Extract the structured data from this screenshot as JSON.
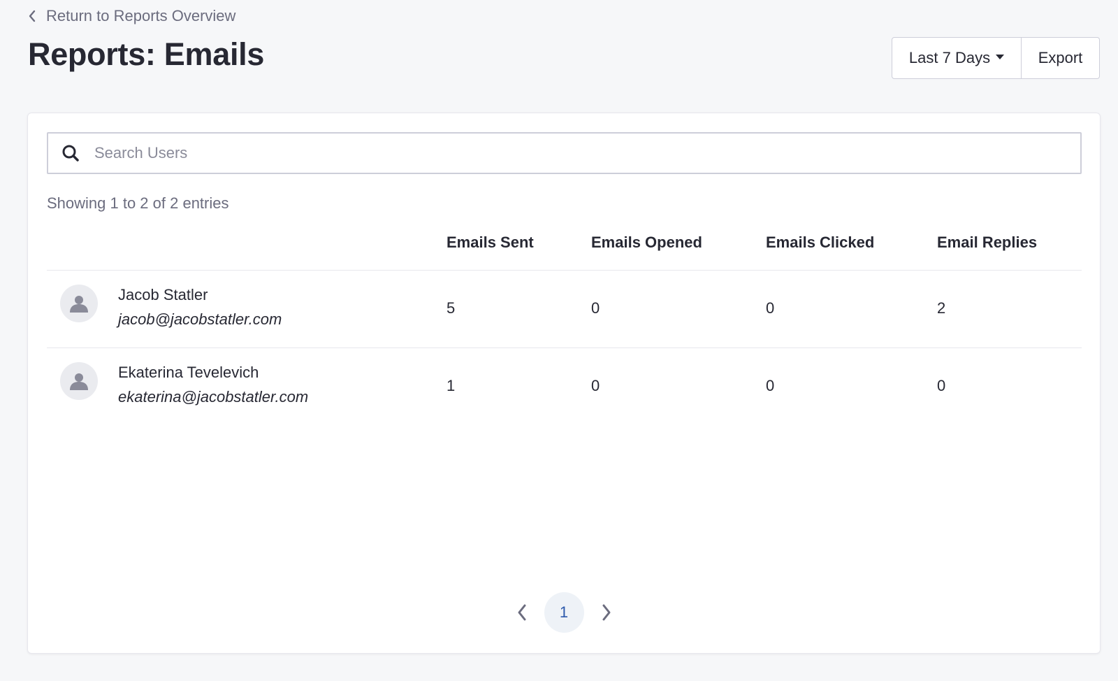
{
  "nav": {
    "back_label": "Return to Reports Overview"
  },
  "header": {
    "title": "Reports: Emails",
    "range_label": "Last 7 Days",
    "export_label": "Export"
  },
  "search": {
    "placeholder": "Search Users",
    "value": ""
  },
  "table": {
    "info": "Showing 1 to 2 of 2 entries",
    "columns": [
      "Emails Sent",
      "Emails Opened",
      "Emails Clicked",
      "Email Replies"
    ],
    "rows": [
      {
        "name": "Jacob Statler",
        "email": "jacob@jacobstatler.com",
        "sent": "5",
        "opened": "0",
        "clicked": "0",
        "replies": "2"
      },
      {
        "name": "Ekaterina Tevelevich",
        "email": "ekaterina@jacobstatler.com",
        "sent": "1",
        "opened": "0",
        "clicked": "0",
        "replies": "0"
      }
    ]
  },
  "pagination": {
    "current_page": "1"
  },
  "colors": {
    "background": "#f6f7f9",
    "text": "#272833",
    "muted": "#6b6c7e",
    "accent": "#2e5aac"
  },
  "icons": {
    "back": "chevron-left-icon",
    "search": "search-icon",
    "avatar": "user-icon",
    "prev": "chevron-left-icon",
    "next": "chevron-right-icon"
  }
}
